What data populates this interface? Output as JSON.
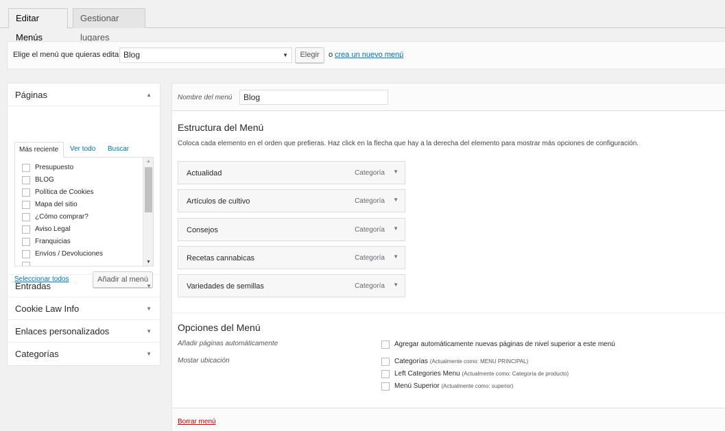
{
  "tabs": [
    {
      "label": "Editar Menús",
      "active": true
    },
    {
      "label": "Gestionar lugares",
      "active": false
    }
  ],
  "manage": {
    "label": "Elige el menú que quieras editar:",
    "selected_menu": "Blog",
    "choose_button": "Elegir",
    "or_text": "o",
    "create_link": "crea un nuevo menú",
    "period": "."
  },
  "sidebar": {
    "pages": {
      "title": "Páginas",
      "tabs": [
        "Más reciente",
        "Ver todo",
        "Buscar"
      ],
      "items": [
        "Presupuesto",
        "BLOG",
        "Política de Cookies",
        "Mapa del sitio",
        "¿Cómo comprar?",
        "Aviso Legal",
        "Franquicias",
        "Envíos / Devoluciones"
      ],
      "select_all": "Seleccionar todos",
      "add_button": "Añadir al menú"
    },
    "sections": [
      "Entradas",
      "Cookie Law Info",
      "Enlaces personalizados",
      "Categorías"
    ]
  },
  "editor": {
    "name_label": "Nombre del menú",
    "name_value": "Blog",
    "structure_title": "Estructura del Menú",
    "structure_instructions": "Coloca cada elemento en el orden que prefieras. Haz click en la flecha que hay a la derecha del elemento para mostrar más opciones de configuración.",
    "items": [
      {
        "title": "Actualidad",
        "type": "Categoría"
      },
      {
        "title": "Artículos de cultivo",
        "type": "Categoría"
      },
      {
        "title": "Consejos",
        "type": "Categoría"
      },
      {
        "title": "Recetas cannabicas",
        "type": "Categoría"
      },
      {
        "title": "Variedades de semillas",
        "type": "Categoría"
      }
    ],
    "options_title": "Opciones del Menú",
    "auto_add_label": "Añadir páginas automáticamente",
    "auto_add_option": "Agregar automáticamente nuevas páginas de nivel superior a este menú",
    "locations_label": "Mostar ubicación",
    "locations": [
      {
        "name": "Categorías",
        "note": "(Actualmente como: MENU PRINCIPAL)"
      },
      {
        "name": "Left Categories Menu",
        "note": "(Actualmente como: Categoría de producto)"
      },
      {
        "name": "Menú Superior",
        "note": "(Actualmente como: superior)"
      }
    ],
    "delete_link": "Borrar menú"
  },
  "icons": {
    "expand": "triangle-down-icon",
    "collapse": "triangle-up-icon"
  },
  "colors": {
    "link": "#0073aa",
    "delete": "#a00000",
    "background": "#f1f1f1"
  }
}
